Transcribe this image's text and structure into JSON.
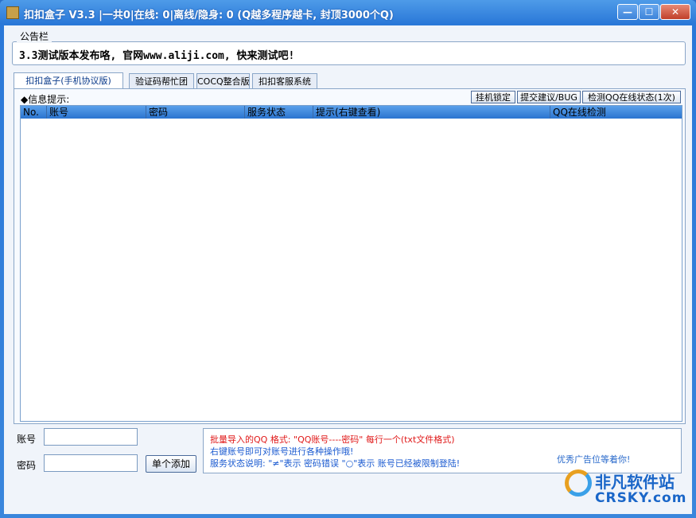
{
  "window": {
    "title": "扣扣盒子 V3.3  |一共0|在线: 0|离线/隐身: 0 (Q越多程序越卡, 封顶3000个Q)",
    "min_glyph": "—",
    "max_glyph": "☐",
    "close_glyph": "✕"
  },
  "notice": {
    "legend": "公告栏",
    "text": "3.3测试版本发布咯, 官网www.aliji.com, 快来测试吧!"
  },
  "tabs": [
    "扣扣盒子(手机协议版)",
    "验证码帮忙团",
    "COCQ整合版",
    "扣扣客服系统"
  ],
  "panel": {
    "info_label": "◆信息提示:",
    "buttons": [
      "挂机锁定",
      "提交建议/BUG",
      "检测QQ在线状态(1次)"
    ],
    "columns": [
      "No.",
      "账号",
      "密码",
      "服务状态",
      "提示(右键查看)",
      "QQ在线检测"
    ]
  },
  "form": {
    "account_label": "账号",
    "account_value": "",
    "password_label": "密码",
    "password_value": "",
    "add_button": "单个添加"
  },
  "help": {
    "line1": "批量导入的QQ 格式: \"QQ账号----密码\" 每行一个(txt文件格式)",
    "line2": "右键账号即可对账号进行各种操作哦!",
    "line3": "服务状态说明: \"≠\"表示 密码错误 \"○\"表示 账号已经被限制登陆!"
  },
  "ad": {
    "text": "优秀广告位等着你!"
  },
  "logo": {
    "main": "非凡软件站",
    "sub": "CRSKY.com"
  },
  "colors": {
    "title_bar": "#2a78d8",
    "table_header": "#2a74d0",
    "help_red": "#e01818",
    "help_blue": "#1a5ad0"
  }
}
